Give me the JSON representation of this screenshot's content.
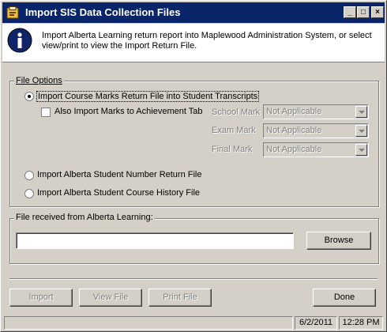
{
  "window": {
    "title": "Import SIS Data Collection Files",
    "controls": {
      "minimize": "_",
      "maximize": "□",
      "close": "×"
    }
  },
  "info": {
    "icon": "info-icon",
    "text": "Import Alberta Learning return report into Maplewood Administration System, or select view/print to view the Import Return File."
  },
  "file_options": {
    "legend": "File Options",
    "options": [
      {
        "label": "Import Course Marks Return File into Student Transcripts",
        "selected": true
      },
      {
        "label": "Import Alberta Student Number Return File",
        "selected": false
      },
      {
        "label": "Import Alberta Student Course History File",
        "selected": false
      }
    ],
    "also_import_label": "Also Import Marks to Achievement Tab",
    "also_import_checked": false,
    "marks": [
      {
        "label": "School Mark",
        "value": "Not Applicable"
      },
      {
        "label": "Exam Mark",
        "value": "Not Applicable"
      },
      {
        "label": "Final Mark",
        "value": "Not Applicable"
      }
    ]
  },
  "file_received": {
    "legend": "File received from Alberta Learning:",
    "path_value": "",
    "browse_label": "Browse"
  },
  "actions": {
    "import_label": "Import",
    "view_label": "View File",
    "print_label": "Print File",
    "done_label": "Done"
  },
  "status": {
    "message": "",
    "date": "6/2/2011",
    "time": "12:28 PM"
  },
  "colors": {
    "titlebar": "#0a246a",
    "face": "#d4d0c8",
    "disabled_text": "#808080"
  }
}
